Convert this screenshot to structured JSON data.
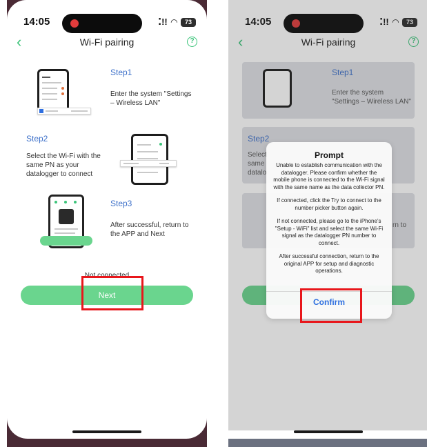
{
  "colors": {
    "accent_green": "#3cc47a",
    "button_green": "#6ad58e",
    "step_blue": "#3d70c9",
    "highlight_red": "#e8161b",
    "confirm_blue": "#2f6fe0"
  },
  "left": {
    "status": {
      "time": "14:05",
      "signal": "⁚!!",
      "battery": "73"
    },
    "nav": {
      "back_icon": "chevron-left-icon",
      "title": "Wi-Fi pairing",
      "help_icon": "question-circle-icon"
    },
    "step1": {
      "title": "Step1",
      "desc": "Enter the system \"Settings – Wireless LAN\""
    },
    "step2": {
      "title": "Step2",
      "desc": "Select the Wi-Fi with the same PN as your datalogger to connect"
    },
    "step3": {
      "title": "Step3",
      "desc": "After successful, return to the APP and Next"
    },
    "not_connected": "Not connected",
    "next_label": "Next"
  },
  "right": {
    "status": {
      "time": "14:05",
      "signal": "⁚!!",
      "battery": "73"
    },
    "nav": {
      "title": "Wi-Fi pairing"
    },
    "bg": {
      "step1_title": "Step1",
      "step1_desc": "Enter the system \"Settings – Wireless LAN\"",
      "step2_title": "Step2",
      "step2_desc_a": "Select",
      "step2_desc_b": "same",
      "step2_desc_c": "datalo",
      "step3_desc": "rn to"
    },
    "dialog": {
      "title": "Prompt",
      "p1": "Unable to establish communication with the datalogger. Please confirm whether the mobile phone is connected to the Wi-Fi signal with the same name as the data collector PN.",
      "p2": "If connected, click the Try to connect to the number picker button again.",
      "p3": "If not connected, please go to the iPhone's \"Setup - WiFi\" list and select the same Wi-Fi signal as the datalogger PN number to connect.",
      "p4": "After successful connection, return to the original APP for setup and diagnostic operations.",
      "confirm_label": "Confirm"
    }
  }
}
